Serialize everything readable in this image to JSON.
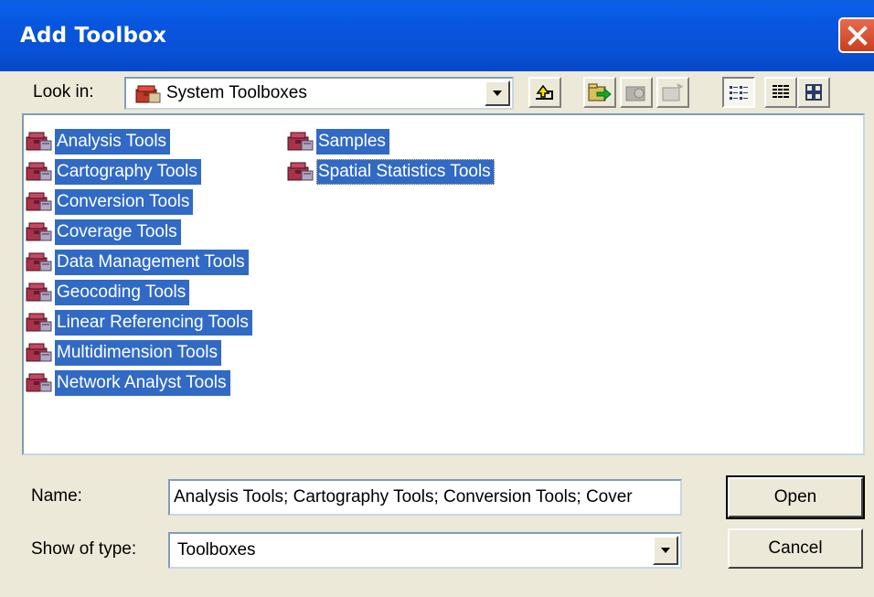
{
  "window": {
    "title": "Add Toolbox"
  },
  "look_in": {
    "label": "Look in:",
    "value": "System Toolboxes",
    "icon": "toolbox-folder-icon"
  },
  "toolbar": {
    "up": "up-one-level-icon",
    "connect": "connect-to-folder-icon",
    "disconnect": "disconnect-folder-icon",
    "new": "new-toolbox-icon",
    "list_view": "list-view-icon",
    "details_view": "details-view-icon",
    "thumbnails_view": "thumbnails-view-icon"
  },
  "items": [
    "Analysis Tools",
    "Cartography Tools",
    "Conversion Tools",
    "Coverage Tools",
    "Data Management Tools",
    "Geocoding Tools",
    "Linear Referencing Tools",
    "Multidimension Tools",
    "Network Analyst Tools",
    "Samples",
    "Spatial Statistics Tools"
  ],
  "name": {
    "label": "Name:",
    "value": "Analysis Tools; Cartography Tools; Conversion Tools; Cover"
  },
  "type": {
    "label": "Show of type:",
    "value": "Toolboxes"
  },
  "buttons": {
    "open": "Open",
    "cancel": "Cancel"
  },
  "colors": {
    "title_bar": "#0a5fe0",
    "selection": "#316ac5",
    "dialog": "#ece9d8"
  }
}
